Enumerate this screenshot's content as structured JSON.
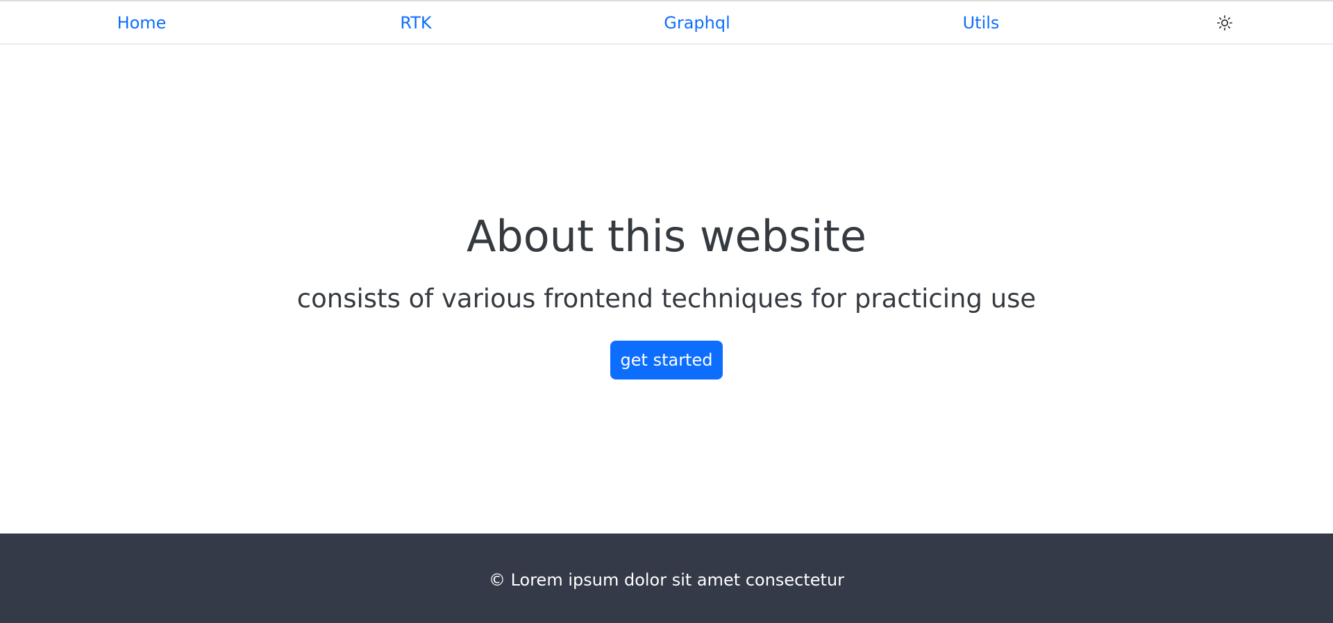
{
  "nav": {
    "items": [
      {
        "label": "Home"
      },
      {
        "label": "RTK"
      },
      {
        "label": "Graphql"
      },
      {
        "label": "Utils"
      }
    ],
    "theme_icon": "sun-icon",
    "link_color": "#0d6efd"
  },
  "hero": {
    "title": "About this website",
    "subtitle": "consists of various frontend techniques for practicing use",
    "button_label": "get started",
    "button_color": "#0d6efd"
  },
  "footer": {
    "text": "© Lorem ipsum dolor sit amet consectetur",
    "background": "#343a48"
  }
}
